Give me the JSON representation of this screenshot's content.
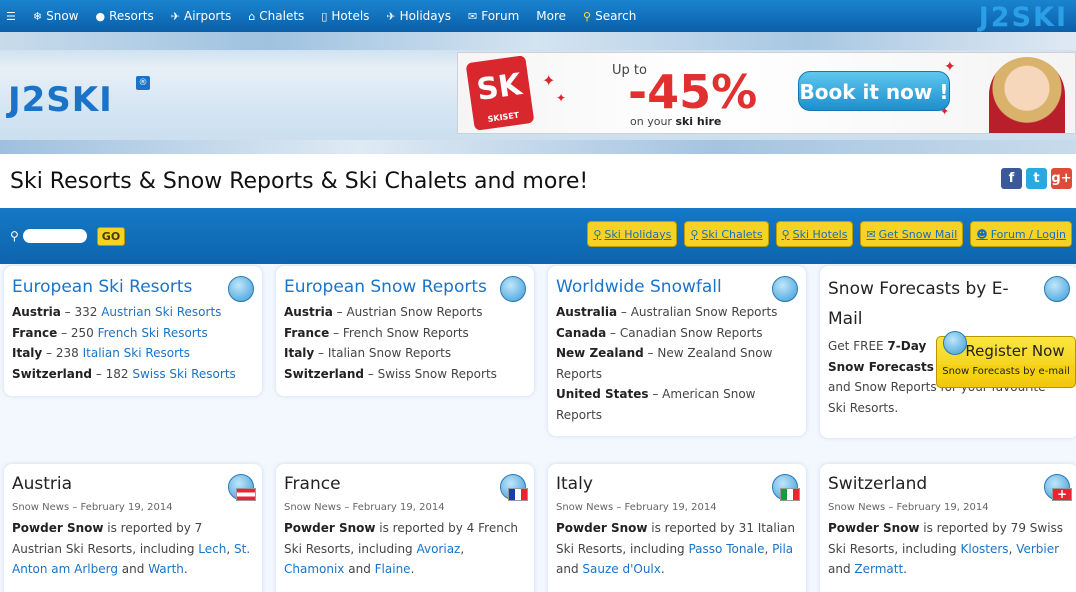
{
  "nav": {
    "menu_icon": "hamburger-icon",
    "items": [
      {
        "label": "Snow",
        "icon": "snowflake-icon",
        "glyph": "❄"
      },
      {
        "label": "Resorts",
        "icon": "globe-icon",
        "glyph": "●"
      },
      {
        "label": "Airports",
        "icon": "plane-icon",
        "glyph": "✈"
      },
      {
        "label": "Chalets",
        "icon": "home-icon",
        "glyph": "⌂"
      },
      {
        "label": "Hotels",
        "icon": "building-icon",
        "glyph": "▯"
      },
      {
        "label": "Holidays",
        "icon": "plane-icon",
        "glyph": "✈"
      },
      {
        "label": "Forum",
        "icon": "chat-icon",
        "glyph": "✉"
      },
      {
        "label": "More",
        "icon": "",
        "glyph": ""
      },
      {
        "label": "Search",
        "icon": "search-icon",
        "glyph": "⚲"
      }
    ],
    "right_logo": "J2SKI"
  },
  "header": {
    "logo": "J2SKI",
    "logo_badge": "®"
  },
  "banner": {
    "brand": "SK",
    "brand_sub": "SKISET",
    "upto": "Up to",
    "discount": "-45%",
    "hire_prefix": "on your ",
    "hire_bold": "ski hire",
    "cta": "Book it now !"
  },
  "page": {
    "title": "Ski Resorts & Snow Reports & Ski Chalets and more!"
  },
  "social": {
    "facebook": "f",
    "twitter": "t",
    "googleplus": "g+"
  },
  "toolbar": {
    "search_placeholder": "",
    "go": "GO",
    "buttons": [
      {
        "label": "Ski Holidays",
        "icon": "search-icon"
      },
      {
        "label": "Ski Chalets",
        "icon": "search-icon"
      },
      {
        "label": "Ski Hotels",
        "icon": "search-icon"
      },
      {
        "label": "Get Snow Mail",
        "icon": "mail-icon"
      },
      {
        "label": "Forum / Login",
        "icon": "user-icon"
      }
    ]
  },
  "cards": {
    "resorts": {
      "title": "European Ski Resorts",
      "rows": [
        {
          "country": "Austria",
          "sep": " – 332 ",
          "link": "Austrian Ski Resorts"
        },
        {
          "country": "France",
          "sep": " – 250 ",
          "link": "French Ski Resorts"
        },
        {
          "country": "Italy",
          "sep": " – 238 ",
          "link": "Italian Ski Resorts"
        },
        {
          "country": "Switzerland",
          "sep": " – 182 ",
          "link": "Swiss Ski Resorts"
        }
      ]
    },
    "reports": {
      "title": "European Snow Reports",
      "rows": [
        {
          "country": "Austria",
          "text": " – Austrian Snow Reports"
        },
        {
          "country": "France",
          "text": " – French Snow Reports"
        },
        {
          "country": "Italy",
          "text": " – Italian Snow Reports"
        },
        {
          "country": "Switzerland",
          "text": " – Swiss Snow Reports"
        }
      ]
    },
    "snowfall": {
      "title": "Worldwide Snowfall",
      "rows": [
        {
          "country": "Australia",
          "text": " – Australian Snow Reports"
        },
        {
          "country": "Canada",
          "text": " – Canadian Snow Reports"
        },
        {
          "country": "New Zealand",
          "text": " – New Zealand Snow Reports"
        },
        {
          "country": "United States",
          "text": " – American Snow Reports"
        }
      ]
    },
    "forecasts": {
      "title": "Snow Forecasts by E-Mail",
      "text_a": "Get FREE ",
      "bold_a": "7-Day Snow Forecasts",
      "text_b": " and Snow Reports for your favourite Ski Resorts.",
      "register": "Register Now",
      "register_sub": "Snow Forecasts by e-mail"
    },
    "news": [
      {
        "country": "Austria",
        "flag": "austria-flag-icon",
        "meta": "Snow News – February 19, 2014",
        "bold": "Powder Snow",
        "text": " is reported by 7 Austrian Ski Resorts, including ",
        "links": [
          "Lech",
          "St. Anton am Arlberg",
          "Warth"
        ],
        "joins": [
          ", ",
          " and ",
          "."
        ]
      },
      {
        "country": "France",
        "flag": "france-flag-icon",
        "meta": "Snow News – February 19, 2014",
        "bold": "Powder Snow",
        "text": " is reported by 4 French Ski Resorts, including ",
        "links": [
          "Avoriaz",
          "Chamonix",
          "Flaine"
        ],
        "joins": [
          ", ",
          " and ",
          "."
        ]
      },
      {
        "country": "Italy",
        "flag": "italy-flag-icon",
        "meta": "Snow News – February 19, 2014",
        "bold": "Powder Snow",
        "text": " is reported by 31 Italian Ski Resorts, including ",
        "links": [
          "Passo Tonale",
          "Pila",
          "Sauze d'Oulx"
        ],
        "joins": [
          ", ",
          " and ",
          "."
        ]
      },
      {
        "country": "Switzerland",
        "flag": "switzerland-flag-icon",
        "meta": "Snow News – February 19, 2014",
        "bold": "Powder Snow",
        "text": " is reported by 79 Swiss Ski Resorts, including ",
        "links": [
          "Klosters",
          "Verbier",
          "Zermatt"
        ],
        "joins": [
          ", ",
          " and ",
          "."
        ]
      }
    ]
  }
}
